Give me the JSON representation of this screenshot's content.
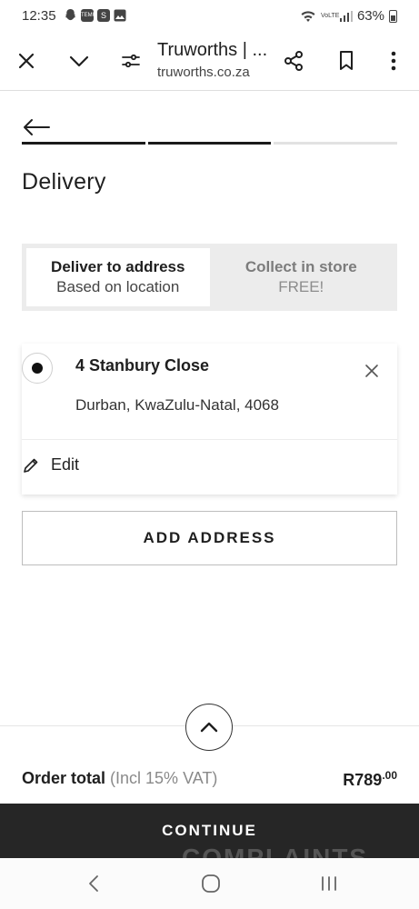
{
  "status_bar": {
    "time": "12:35",
    "notification_icons": [
      "snapchat-icon",
      "temu-icon",
      "s-app-icon",
      "gallery-icon"
    ],
    "temu_label": "TEMU",
    "s_label": "S",
    "network_label": "VoLTE",
    "battery": "63%"
  },
  "browser": {
    "title": "Truworths | ...",
    "url": "truworths.co.za"
  },
  "checkout": {
    "steps": [
      {
        "state": "done"
      },
      {
        "state": "done"
      },
      {
        "state": "pending"
      }
    ],
    "title": "Delivery",
    "options": [
      {
        "line1": "Deliver to address",
        "line2": "Based on location",
        "active": true
      },
      {
        "line1": "Collect in store",
        "line2": "FREE!",
        "active": false
      }
    ],
    "address": {
      "line1": "4 Stanbury Close",
      "line2": "Durban, KwaZulu-Natal, 4068",
      "edit_label": "Edit"
    },
    "add_address_label": "ADD ADDRESS"
  },
  "summary": {
    "label": "Order total",
    "sub_label": "(Incl 15% VAT)",
    "amount_main": "R789",
    "amount_cents": ".00",
    "continue_label": "CONTINUE"
  },
  "watermark": "COMPLAINTS",
  "colors": {
    "dark": "#262626",
    "toggle_bg": "#ececec",
    "inactive_text": "#7c7c7c"
  }
}
